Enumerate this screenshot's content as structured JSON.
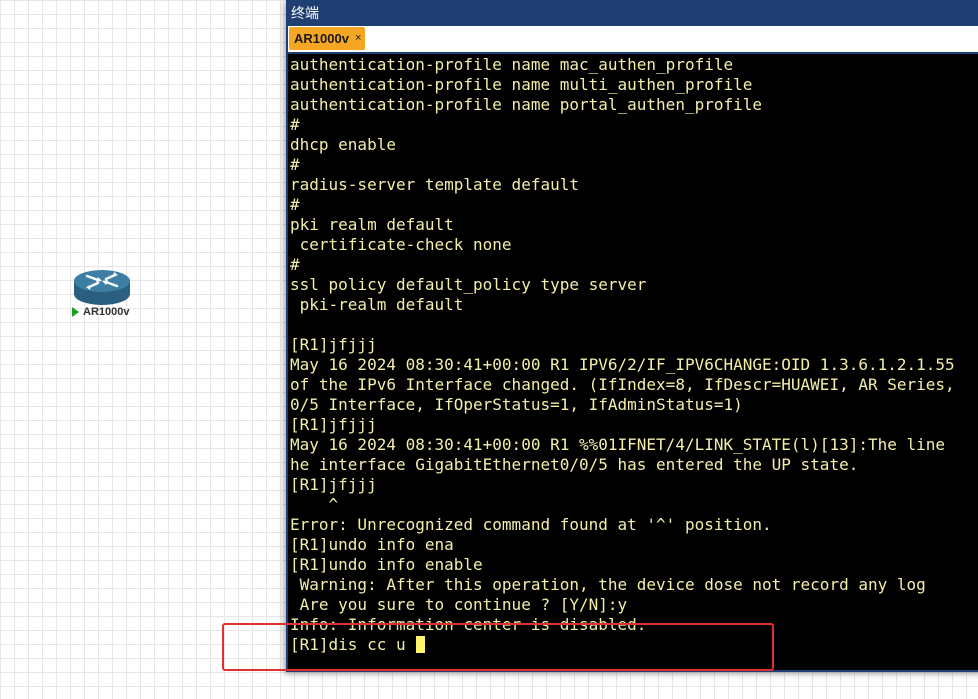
{
  "device": {
    "label": "AR1000v",
    "status_icon": "play-icon",
    "icon": "router-icon",
    "status_color": "#1a9e2a",
    "body_color": "#2f6d8f"
  },
  "terminal": {
    "title": "终端",
    "tab_label": "AR1000v",
    "tab_close": "×",
    "text_color": "#f3eeaa",
    "lines": [
      "authentication-profile name mac_authen_profile",
      "authentication-profile name multi_authen_profile",
      "authentication-profile name portal_authen_profile",
      "#",
      "dhcp enable",
      "#",
      "radius-server template default",
      "#",
      "pki realm default",
      " certificate-check none",
      "#",
      "ssl policy default_policy type server",
      " pki-realm default",
      "",
      "[R1]jfjjj",
      "May 16 2024 08:30:41+00:00 R1 IPV6/2/IF_IPV6CHANGE:OID 1.3.6.1.2.1.55",
      "of the IPv6 Interface changed. (IfIndex=8, IfDescr=HUAWEI, AR Series,",
      "0/5 Interface, IfOperStatus=1, IfAdminStatus=1)",
      "[R1]jfjjj",
      "May 16 2024 08:30:41+00:00 R1 %%01IFNET/4/LINK_STATE(l)[13]:The line",
      "he interface GigabitEthernet0/0/5 has entered the UP state.",
      "[R1]jfjjj",
      "    ^",
      "Error: Unrecognized command found at '^' position.",
      "[R1]undo info ena",
      "[R1]undo info enable",
      " Warning: After this operation, the device dose not record any log",
      " Are you sure to continue ? [Y/N]:y",
      "Info: Information center is disabled."
    ],
    "input_line": "[R1]dis cc u "
  },
  "annotation": {
    "highlight_color": "#e03030"
  }
}
